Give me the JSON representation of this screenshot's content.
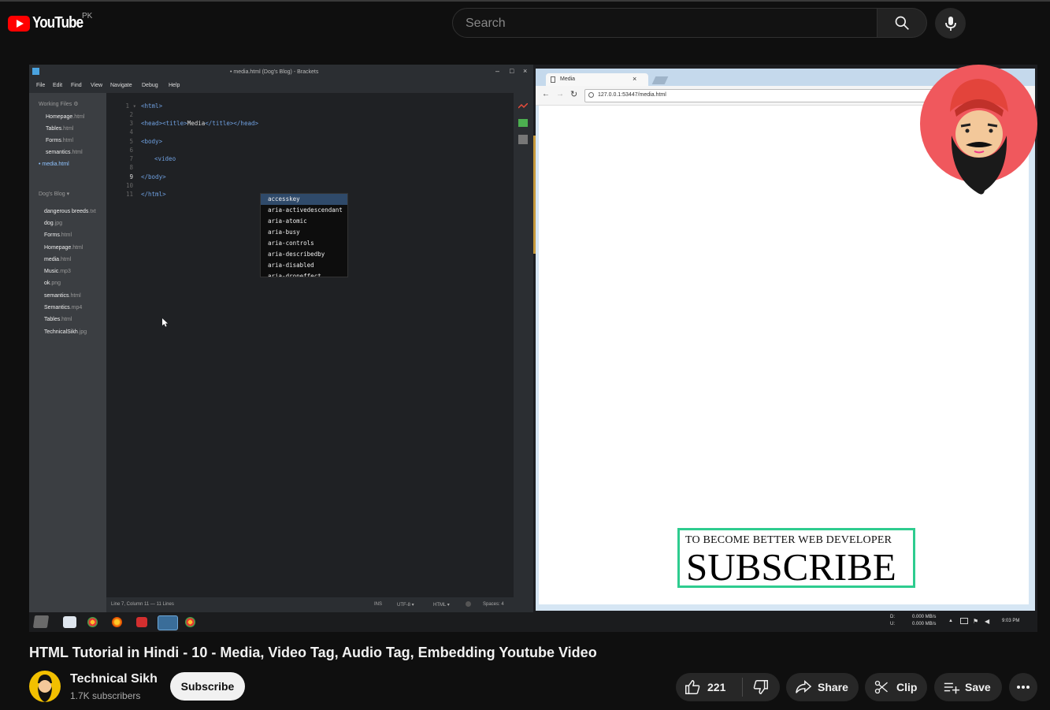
{
  "header": {
    "logo_text": "YouTube",
    "country": "PK",
    "search_placeholder": "Search"
  },
  "editor": {
    "window_title": "• media.html (Dog's Blog) - Brackets",
    "menu": [
      "File",
      "Edit",
      "Find",
      "View",
      "Navigate",
      "Debug",
      "Help"
    ],
    "working_files_header": "Working Files ⚙",
    "working_files": [
      {
        "name": "Homepage",
        "ext": ".html"
      },
      {
        "name": "Tables",
        "ext": ".html"
      },
      {
        "name": "Forms",
        "ext": ".html"
      },
      {
        "name": "semantics",
        "ext": ".html"
      },
      {
        "name": "• media",
        "ext": ".html"
      }
    ],
    "project_header": "Dog's Blog ▾",
    "project_files": [
      {
        "name": "dangerous breeds",
        "ext": ".txt"
      },
      {
        "name": "dog",
        "ext": ".jpg"
      },
      {
        "name": "Forms",
        "ext": ".html"
      },
      {
        "name": "Homepage",
        "ext": ".html"
      },
      {
        "name": "media",
        "ext": ".html"
      },
      {
        "name": "Music",
        "ext": ".mp3"
      },
      {
        "name": "ok",
        "ext": ".png"
      },
      {
        "name": "semantics",
        "ext": ".html"
      },
      {
        "name": "Semantics",
        "ext": ".mp4"
      },
      {
        "name": "Tables",
        "ext": ".html"
      },
      {
        "name": "TechnicalSikh",
        "ext": ".jpg"
      }
    ],
    "line_numbers": [
      "1 ▾",
      "2",
      "3",
      "4",
      "5",
      "6",
      "7",
      "8",
      "9",
      "10",
      "11"
    ],
    "code": {
      "l1": "<html>",
      "l3a": "<head><title>",
      "l3b": "Media",
      "l3c": "</title></head>",
      "l5": "<body>",
      "l7": "<video",
      "l9": "</body>",
      "l11": "</html>"
    },
    "autocomplete": [
      "accesskey",
      "aria-activedescendant",
      "aria-atomic",
      "aria-busy",
      "aria-controls",
      "aria-describedby",
      "aria-disabled",
      "aria-dropeffect"
    ],
    "status": {
      "position": "Line 7, Column 11 — 11 Lines",
      "ins": "INS",
      "encoding": "UTF-8 ▾",
      "language": "HTML ▾",
      "spaces": "Spaces: 4"
    }
  },
  "browser": {
    "tab_title": "Media",
    "url": "127.0.0.1:53447/media.html",
    "subscribe_small": "TO BECOME BETTER WEB DEVELOPER",
    "subscribe_big": "SUBSCRIBE"
  },
  "taskbar": {
    "net_d_label": "D:",
    "net_u_label": "U:",
    "net_d": "0.000 MB/s",
    "net_u": "0.000 MB/s",
    "time": "9:03 PM"
  },
  "video_info": {
    "title": "HTML Tutorial in Hindi - 10 - Media, Video Tag, Audio Tag, Embedding Youtube Video",
    "channel_name": "Technical Sikh",
    "subscribers": "1.7K subscribers",
    "subscribe_label": "Subscribe",
    "like_count": "221",
    "share_label": "Share",
    "clip_label": "Clip",
    "save_label": "Save"
  },
  "colors": {
    "brand_red": "#ff0000",
    "page_bg": "#0f0f0f",
    "pill_bg": "#272727",
    "subscribe_border": "#2ecc8f",
    "avatar_bg": "#f0585d"
  }
}
